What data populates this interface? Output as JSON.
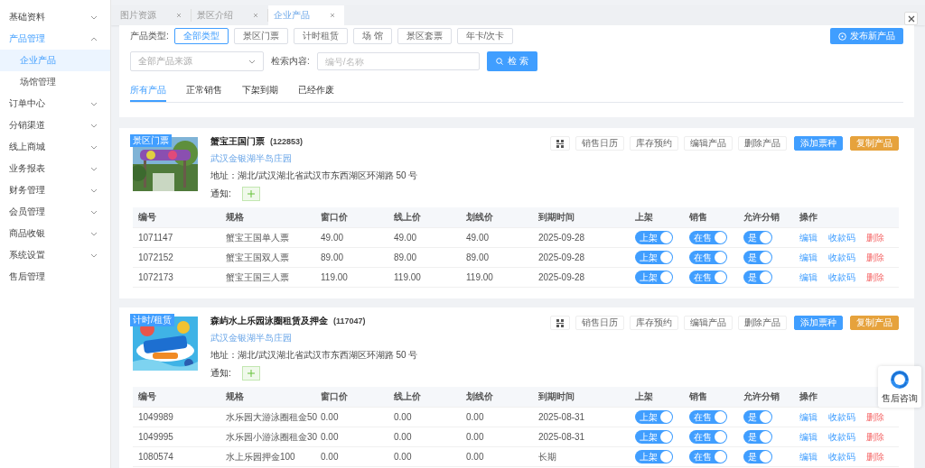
{
  "sidebar": {
    "items": [
      {
        "label": "基础资料",
        "expanded": false
      },
      {
        "label": "产品管理",
        "expanded": true,
        "children": [
          {
            "label": "企业产品",
            "selected": true
          },
          {
            "label": "场馆管理",
            "selected": false
          }
        ]
      },
      {
        "label": "订单中心",
        "expanded": false
      },
      {
        "label": "分销渠道",
        "expanded": false
      },
      {
        "label": "线上商城",
        "expanded": false
      },
      {
        "label": "业务报表",
        "expanded": false
      },
      {
        "label": "财务管理",
        "expanded": false
      },
      {
        "label": "会员管理",
        "expanded": false
      },
      {
        "label": "商品收银",
        "expanded": false
      },
      {
        "label": "系统设置",
        "expanded": false
      },
      {
        "label": "售后管理"
      }
    ]
  },
  "tabs": [
    {
      "label": "图片资源",
      "selected": false
    },
    {
      "label": "景区介绍",
      "selected": false
    },
    {
      "label": "企业产品",
      "selected": true
    }
  ],
  "filters": {
    "type_label": "产品类型:",
    "types": [
      {
        "label": "全部类型",
        "selected": true
      },
      {
        "label": "景区门票",
        "selected": false
      },
      {
        "label": "计时租赁",
        "selected": false
      },
      {
        "label": "场 馆",
        "selected": false
      },
      {
        "label": "景区套票",
        "selected": false
      },
      {
        "label": "年卡/次卡",
        "selected": false
      }
    ],
    "source_select": {
      "placeholder": "全部产品来源"
    },
    "search_label": "检索内容:",
    "search_field": {
      "placeholder": "编号/名称"
    },
    "search_button": "检 索",
    "publish_button": "发布新产品"
  },
  "sub_tabs": [
    {
      "label": "所有产品",
      "selected": true
    },
    {
      "label": "正常销售",
      "selected": false
    },
    {
      "label": "下架到期",
      "selected": false
    },
    {
      "label": "已经作废",
      "selected": false
    }
  ],
  "products": [
    {
      "badge": "景区门票",
      "picture": {
        "kind": "picture"
      },
      "name": "蟹宝王国门票",
      "code": "(122853)",
      "venue": "武汉金银湖半岛庄园",
      "address": "地址：湖北/武汉湖北省武汉市东西湖区环湖路 50 号",
      "notice_label": "通知:",
      "actions": [
        {
          "kind": "qr"
        },
        {
          "kind": "plain",
          "label": "销售日历"
        },
        {
          "kind": "plain",
          "label": "库存预约"
        },
        {
          "kind": "plain",
          "label": "编辑产品"
        },
        {
          "kind": "plain",
          "label": "删除产品"
        },
        {
          "kind": "primary",
          "label": "添加票种"
        },
        {
          "kind": "warning",
          "label": "复制产品"
        }
      ],
      "columns": [
        "编号",
        "规格",
        "窗口价",
        "线上价",
        "划线价",
        "到期时间",
        "上架",
        "销售",
        "允许分销",
        "操作"
      ],
      "rows": [
        {
          "cells": [
            "1071147",
            "蟹宝王国单人票",
            "49.00",
            "49.00",
            "49.00",
            "2025-09-28"
          ],
          "switches": [
            {
              "label": "上架",
              "on": true
            },
            {
              "label": "在售",
              "on": true
            },
            {
              "label": "是",
              "on": true
            }
          ],
          "ops": [
            {
              "label": "编辑",
              "kind": "link"
            },
            {
              "label": "收款码",
              "kind": "link"
            },
            {
              "label": "删除",
              "kind": "danger"
            }
          ]
        },
        {
          "cells": [
            "1072152",
            "蟹宝王国双人票",
            "89.00",
            "89.00",
            "89.00",
            "2025-09-28"
          ],
          "switches": [
            {
              "label": "上架",
              "on": true
            },
            {
              "label": "在售",
              "on": true
            },
            {
              "label": "是",
              "on": true
            }
          ],
          "ops": [
            {
              "label": "编辑",
              "kind": "link"
            },
            {
              "label": "收款码",
              "kind": "link"
            },
            {
              "label": "删除",
              "kind": "danger"
            }
          ]
        },
        {
          "cells": [
            "1072173",
            "蟹宝王国三人票",
            "119.00",
            "119.00",
            "119.00",
            "2025-09-28"
          ],
          "switches": [
            {
              "label": "上架",
              "on": true
            },
            {
              "label": "在售",
              "on": true
            },
            {
              "label": "是",
              "on": true
            }
          ],
          "ops": [
            {
              "label": "编辑",
              "kind": "link"
            },
            {
              "label": "收款码",
              "kind": "link"
            },
            {
              "label": "删除",
              "kind": "danger"
            }
          ]
        }
      ]
    },
    {
      "badge": "计时/租赁",
      "picture": {
        "kind": "picture"
      },
      "name": "森屿水上乐园泳圈租赁及押金",
      "code": "(117047)",
      "venue": "武汉金银湖半岛庄园",
      "address": "地址：湖北/武汉湖北省武汉市东西湖区环湖路 50 号",
      "notice_label": "通知:",
      "actions": [
        {
          "kind": "qr"
        },
        {
          "kind": "plain",
          "label": "销售日历"
        },
        {
          "kind": "plain",
          "label": "库存预约"
        },
        {
          "kind": "plain",
          "label": "编辑产品"
        },
        {
          "kind": "plain",
          "label": "删除产品"
        },
        {
          "kind": "primary",
          "label": "添加票种"
        },
        {
          "kind": "warning",
          "label": "复制产品"
        }
      ],
      "columns": [
        "编号",
        "规格",
        "窗口价",
        "线上价",
        "划线价",
        "到期时间",
        "上架",
        "销售",
        "允许分销",
        "操作"
      ],
      "rows": [
        {
          "cells": [
            "1049989",
            "水乐园大游泳圈租金50",
            "0.00",
            "0.00",
            "0.00",
            "2025-08-31"
          ],
          "switches": [
            {
              "label": "上架",
              "on": true
            },
            {
              "label": "在售",
              "on": true
            },
            {
              "label": "是",
              "on": true
            }
          ],
          "ops": [
            {
              "label": "编辑",
              "kind": "link"
            },
            {
              "label": "收款码",
              "kind": "link"
            },
            {
              "label": "删除",
              "kind": "danger"
            }
          ]
        },
        {
          "cells": [
            "1049995",
            "水乐园小游泳圈租金30",
            "0.00",
            "0.00",
            "0.00",
            "2025-08-31"
          ],
          "switches": [
            {
              "label": "上架",
              "on": true
            },
            {
              "label": "在售",
              "on": true
            },
            {
              "label": "是",
              "on": true
            }
          ],
          "ops": [
            {
              "label": "编辑",
              "kind": "link"
            },
            {
              "label": "收款码",
              "kind": "link"
            },
            {
              "label": "删除",
              "kind": "danger"
            }
          ]
        },
        {
          "cells": [
            "1080574",
            "水上乐园押金100",
            "0.00",
            "0.00",
            "0.00",
            "长期"
          ],
          "switches": [
            {
              "label": "上架",
              "on": true
            },
            {
              "label": "在售",
              "on": true
            },
            {
              "label": "是",
              "on": true
            }
          ],
          "ops": [
            {
              "label": "编辑",
              "kind": "link"
            },
            {
              "label": "收款码",
              "kind": "link"
            },
            {
              "label": "删除",
              "kind": "danger"
            }
          ]
        }
      ]
    }
  ],
  "help_widget": {
    "label": "售后咨询"
  }
}
